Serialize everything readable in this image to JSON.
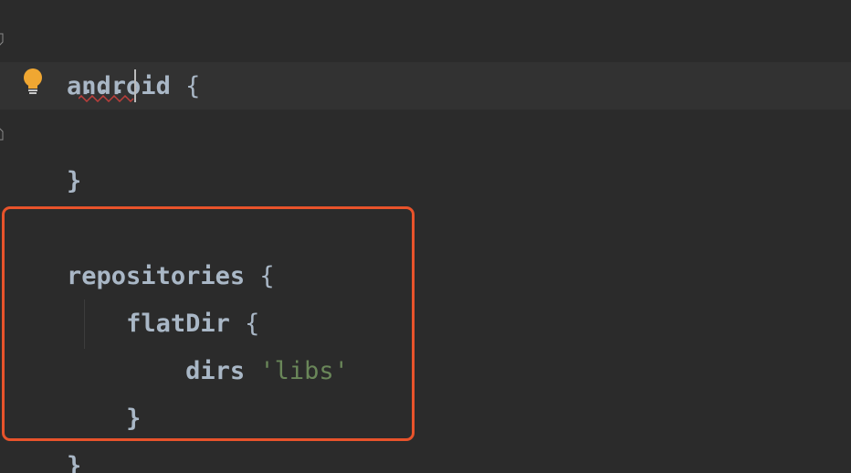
{
  "editor": {
    "lines": [
      {
        "id": "android-open",
        "keyword": "android",
        "brace": " {"
      },
      {
        "id": "android-folded",
        "text": "..."
      },
      {
        "id": "android-close",
        "brace": "}"
      },
      {
        "id": "repositories-open",
        "keyword": "repositories",
        "brace": " {"
      },
      {
        "id": "flatdir-open",
        "indent": "    ",
        "keyword": "flatDir",
        "brace": " {"
      },
      {
        "id": "dirs-line",
        "indent": "        ",
        "keyword": "dirs",
        "space": " ",
        "string": "'libs'"
      },
      {
        "id": "flatdir-close",
        "indent": "    ",
        "brace": "}"
      },
      {
        "id": "repositories-close",
        "brace": "}"
      }
    ]
  },
  "icons": {
    "intention": "lightbulb-icon",
    "fold": "fold-marker-icon"
  },
  "colors": {
    "background": "#2b2b2b",
    "current_line": "#323232",
    "text": "#a9b7c6",
    "string": "#6a8759",
    "highlight_border": "#e8532b",
    "bulb": "#f0a732",
    "squiggle": "#bc3f3c"
  }
}
